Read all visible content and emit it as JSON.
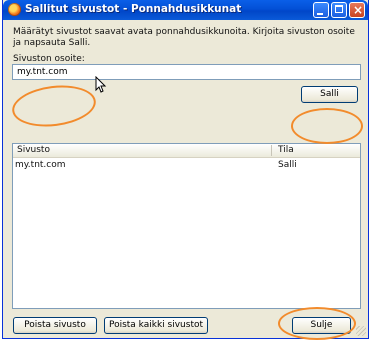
{
  "window": {
    "title": "Sallitut sivustot - Ponnahdusikkunat",
    "description": "Määrätyt sivustot saavat avata ponnahdusikkunoita. Kirjoita sivuston osoite ja napsauta Salli."
  },
  "address": {
    "label": "Sivuston osoite:",
    "value": "my.tnt.com"
  },
  "buttons": {
    "allow": "Salli",
    "remove_site": "Poista sivusto",
    "remove_all": "Poista kaikki sivustot",
    "close": "Sulje"
  },
  "list": {
    "columns": [
      "Sivusto",
      "Tila"
    ],
    "rows": [
      {
        "site": "my.tnt.com",
        "status": "Salli"
      }
    ]
  },
  "icons": {
    "app": "firefox-icon",
    "minimize": "minimize-icon",
    "maximize": "maximize-icon",
    "close": "close-icon",
    "cursor": "mouse-pointer-icon"
  },
  "colors": {
    "titlebar": "#0350d6",
    "annotation": "#f28b2c",
    "dialog_bg": "#ece9d8"
  }
}
